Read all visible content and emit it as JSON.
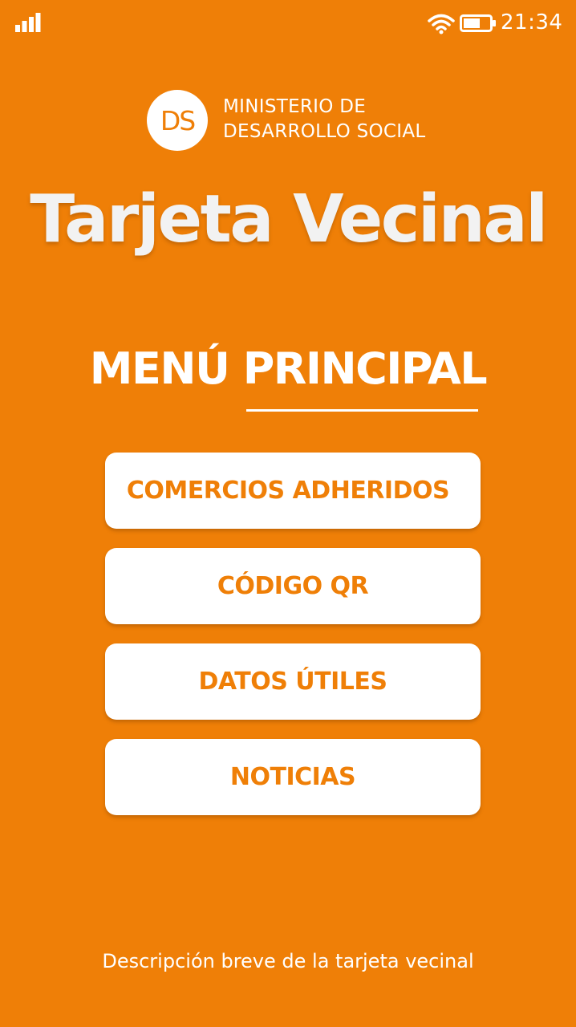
{
  "status_bar": {
    "time": "21:34",
    "icons": [
      "signal-icon",
      "wifi-icon",
      "battery-icon"
    ]
  },
  "logo": {
    "initials": "DS",
    "ministry_line1": "MINISTERIO DE",
    "ministry_line2": "DESARROLLO SOCIAL"
  },
  "app_title": "Tarjeta Vecinal",
  "menu": {
    "heading": "MENÚ PRINCIPAL",
    "buttons": [
      {
        "label": "COMERCIOS ADHERIDOS"
      },
      {
        "label": "CÓDIGO QR"
      },
      {
        "label": "DATOS ÚTILES"
      },
      {
        "label": "NOTICIAS"
      }
    ]
  },
  "footer": {
    "link_text": "Descripción breve de la tarjeta vecinal"
  },
  "colors": {
    "background": "#EF7F07",
    "button_background": "#FFFFFF",
    "button_text": "#EF7F07"
  }
}
